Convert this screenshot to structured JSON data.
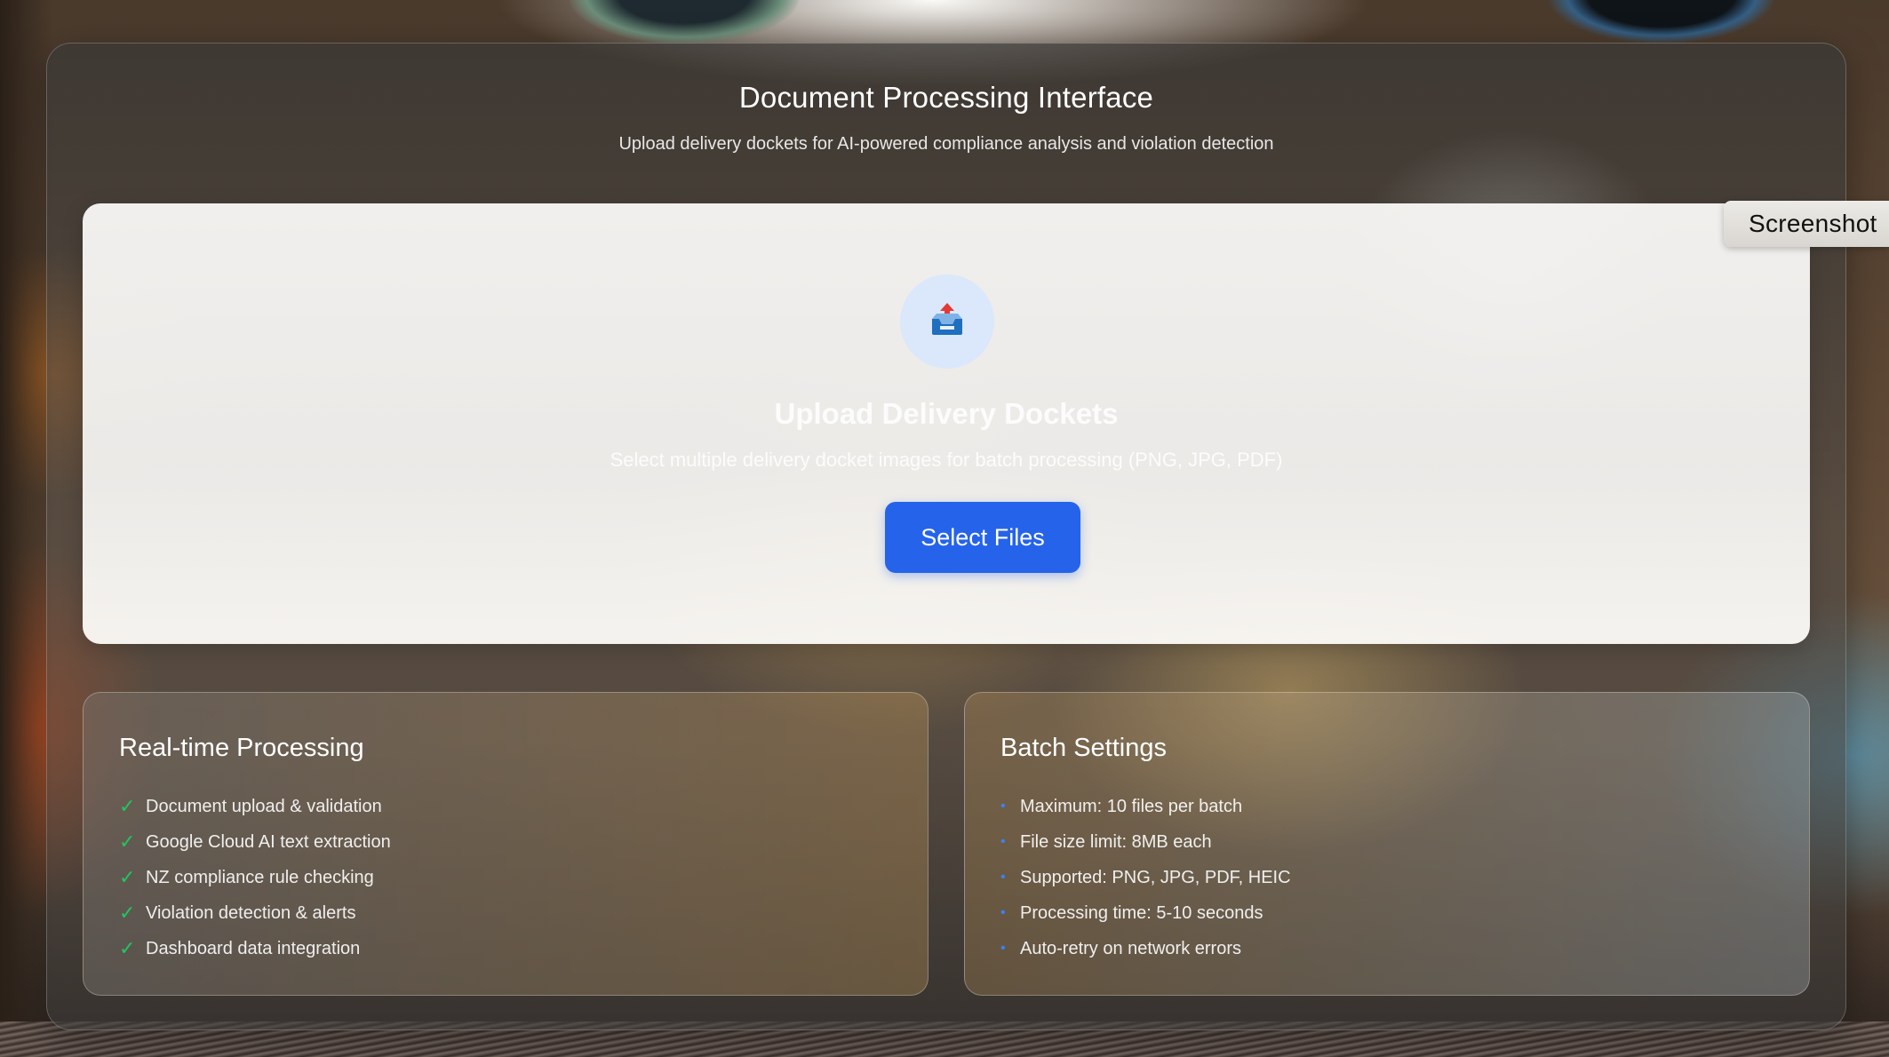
{
  "header": {
    "title": "Document Processing Interface",
    "subtitle": "Upload delivery dockets for AI-powered compliance analysis and violation detection"
  },
  "upload": {
    "icon": "inbox-tray-upload-icon",
    "heading": "Upload Delivery Dockets",
    "description": "Select multiple delivery docket images for batch processing (PNG, JPG, PDF)",
    "button_label": "Select Files"
  },
  "processing": {
    "title": "Real-time Processing",
    "items": [
      "Document upload & validation",
      "Google Cloud AI text extraction",
      "NZ compliance rule checking",
      "Violation detection & alerts",
      "Dashboard data integration"
    ]
  },
  "batch": {
    "title": "Batch Settings",
    "items": [
      "Maximum: 10 files per batch",
      "File size limit: 8MB each",
      "Supported: PNG, JPG, PDF, HEIC",
      "Processing time: 5-10 seconds",
      "Auto-retry on network errors"
    ]
  },
  "overlay": {
    "screenshot_label": "Screenshot"
  },
  "colors": {
    "primary_button": "#2563eb",
    "check": "#22c55e",
    "bullet": "#3b82f6",
    "icon_bg": "#dbe8fb"
  }
}
